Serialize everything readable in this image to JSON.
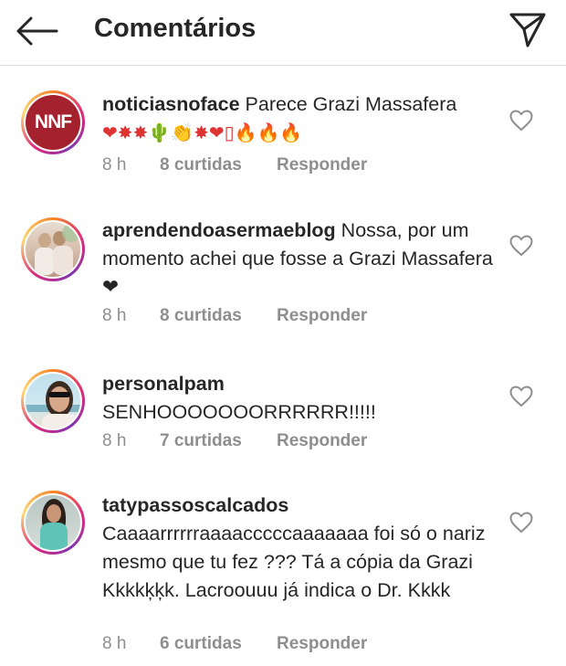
{
  "header": {
    "title": "Comentários",
    "back_icon": "arrow-left-icon",
    "send_icon": "paper-plane-icon"
  },
  "colors": {
    "meta_gray": "#8e8e8e",
    "text": "#262626",
    "nnf_red": "#a4222e"
  },
  "comments": [
    {
      "username": "noticiasnoface",
      "text": "Parece Grazi Massafera",
      "text_line2": "❤✸✸🌵👏✸❤▯🔥🔥🔥",
      "time": "8 h",
      "likes": "8 curtidas",
      "reply": "Responder",
      "avatar_label": "NNF"
    },
    {
      "username": "aprendendoasermaeblog",
      "text": "Nossa, por um momento achei que fosse a Grazi Massafera ❤",
      "time": "8 h",
      "likes": "8 curtidas",
      "reply": "Responder"
    },
    {
      "username": "personalpam",
      "text": "SENHOOOOOOORRRRRR!!!!!",
      "time": "8 h",
      "likes": "7 curtidas",
      "reply": "Responder"
    },
    {
      "username": "tatypassoscalcados",
      "text": "Caaaarrrrrraaaacccccaaaaaaa  foi só o nariz mesmo que tu fez ??? Tá a cópia da Grazi Kkkkķķk. Lacroouuu  já indica o Dr. Kkkk",
      "time": "8 h",
      "likes": "6 curtidas",
      "reply": "Responder"
    }
  ]
}
